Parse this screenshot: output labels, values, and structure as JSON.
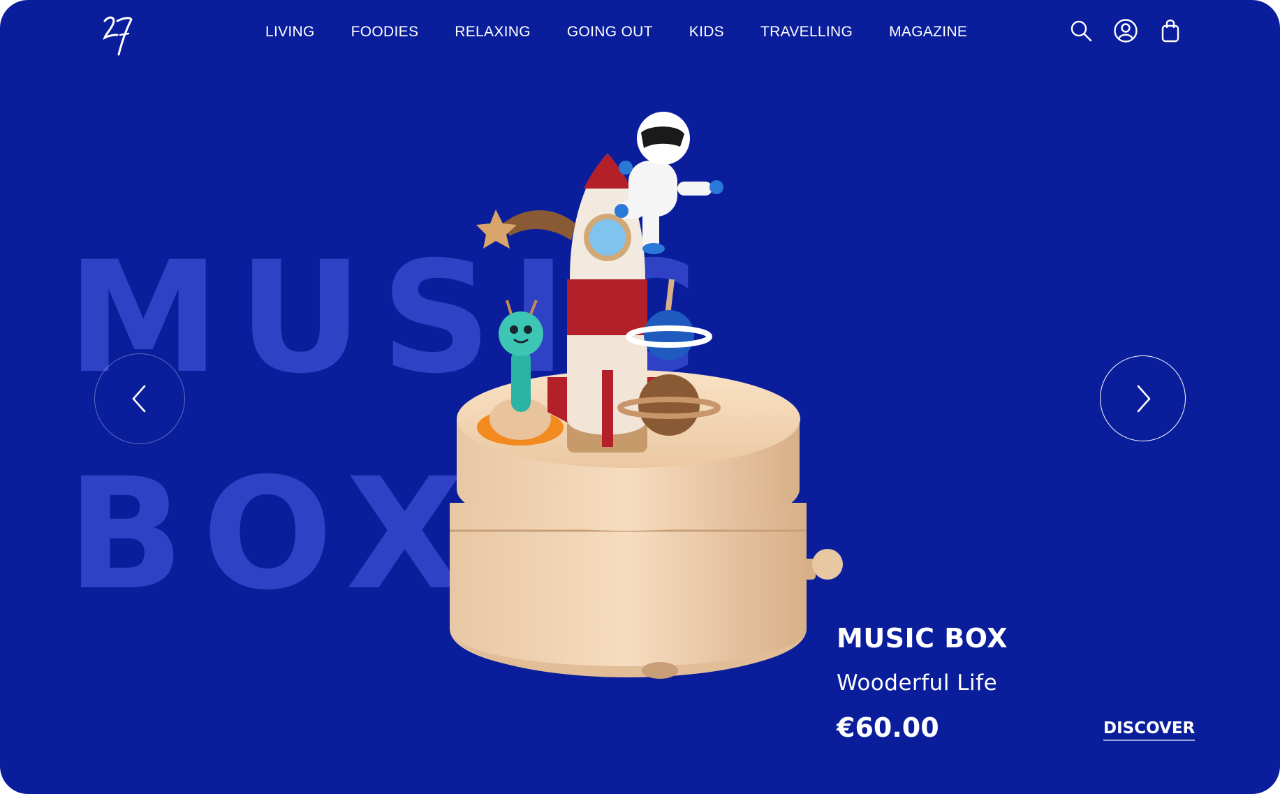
{
  "colors": {
    "background": "#0a1e9c",
    "text": "#ffffff",
    "bg_title": "#3a4bd0"
  },
  "brand": {
    "logo_text": "27"
  },
  "nav": {
    "items": [
      {
        "label": "LIVING"
      },
      {
        "label": "FOODIES"
      },
      {
        "label": "RELAXING"
      },
      {
        "label": "GOING OUT"
      },
      {
        "label": "KIDS"
      },
      {
        "label": "TRAVELLING"
      },
      {
        "label": "MAGAZINE"
      }
    ]
  },
  "header_icons": [
    "search-icon",
    "account-icon",
    "bag-icon"
  ],
  "hero": {
    "bg_title_line1": "MUSIC",
    "bg_title_line2": "BOX",
    "product_name": "MUSIC BOX",
    "product_subtitle": "Wooderful Life",
    "price": "€60.00",
    "cta_label": "DISCOVER",
    "prev_icon": "chevron-left-icon",
    "next_icon": "chevron-right-icon"
  }
}
